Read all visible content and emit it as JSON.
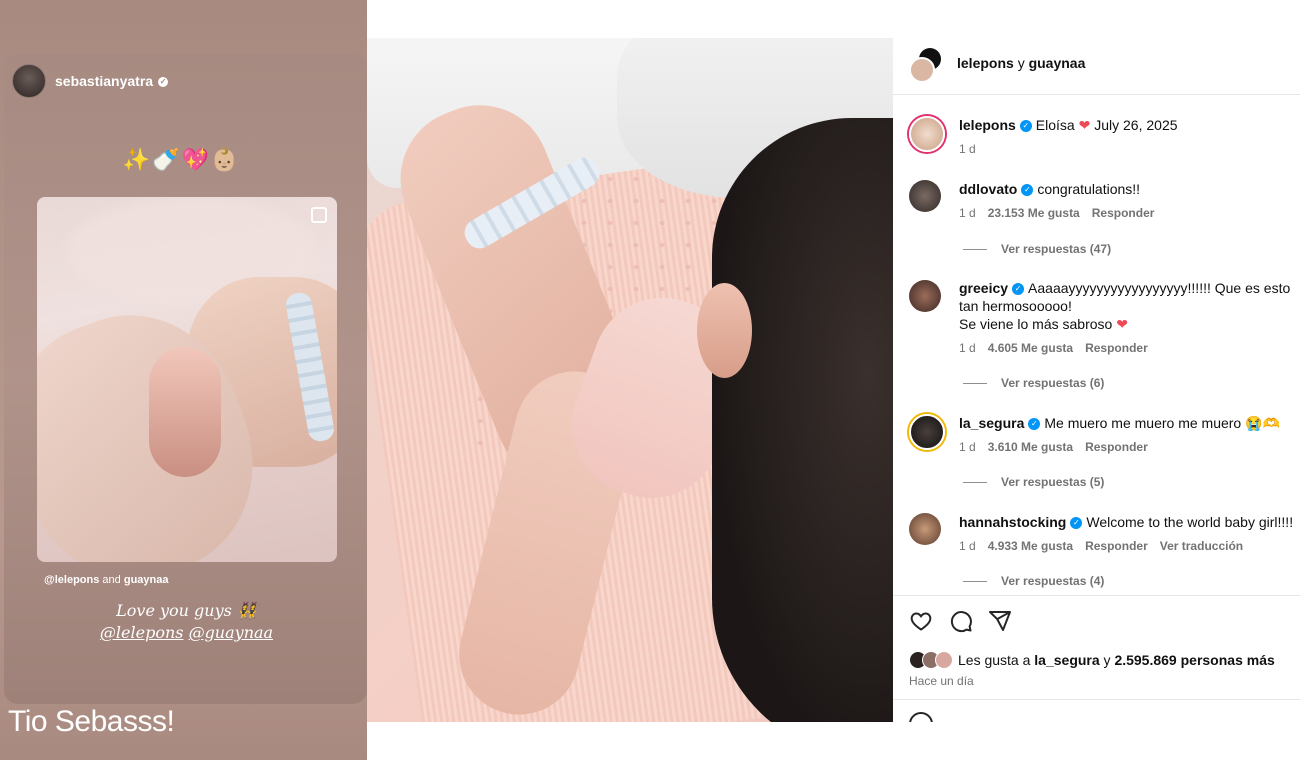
{
  "story": {
    "username": "sebastianyatra",
    "emojis": "✨🍼💖👶🏼",
    "mention_prefix": "@lelepons",
    "mention_and": "and",
    "mention_second": "guaynaa",
    "love_line1": "Love you guys 👯‍♀️",
    "love_mention1": "@lelepons",
    "love_mention2": "@guaynaa",
    "caption": "Tio Sebasss!"
  },
  "post": {
    "header": {
      "user1": "lelepons",
      "joiner": "y",
      "user2": "guaynaa"
    },
    "caption": {
      "username": "lelepons",
      "text": "Eloísa",
      "date": "July 26, 2025",
      "time": "1 d"
    },
    "comments": [
      {
        "username": "ddlovato",
        "text": "congratulations!!",
        "time": "1 d",
        "likes": "23.153 Me gusta",
        "reply": "Responder",
        "replies": "Ver respuestas (47)"
      },
      {
        "username": "greeicy",
        "text": "Aaaaayyyyyyyyyyyyyyyyy!!!!!! Que es esto tan hermosooooo!",
        "text2": "Se viene lo más sabroso",
        "time": "1 d",
        "likes": "4.605 Me gusta",
        "reply": "Responder",
        "replies": "Ver respuestas (6)"
      },
      {
        "username": "la_segura",
        "text": "Me muero me muero me muero 😭🫶",
        "time": "1 d",
        "likes": "3.610 Me gusta",
        "reply": "Responder",
        "replies": "Ver respuestas (5)"
      },
      {
        "username": "hannahstocking",
        "text": "Welcome to the world baby girl!!!!",
        "time": "1 d",
        "likes": "4.933 Me gusta",
        "reply": "Responder",
        "translate": "Ver traducción",
        "replies": "Ver respuestas (4)"
      }
    ],
    "likes": {
      "prefix": "Les gusta a",
      "user": "la_segura",
      "joiner": "y",
      "count": "2.595.869 personas más"
    },
    "posted_ago": "Hace un día"
  },
  "colors": {
    "story_bg": "#a88a80",
    "verified": "#0095f6",
    "heart": "#ed4956",
    "meta_text": "#737373"
  }
}
